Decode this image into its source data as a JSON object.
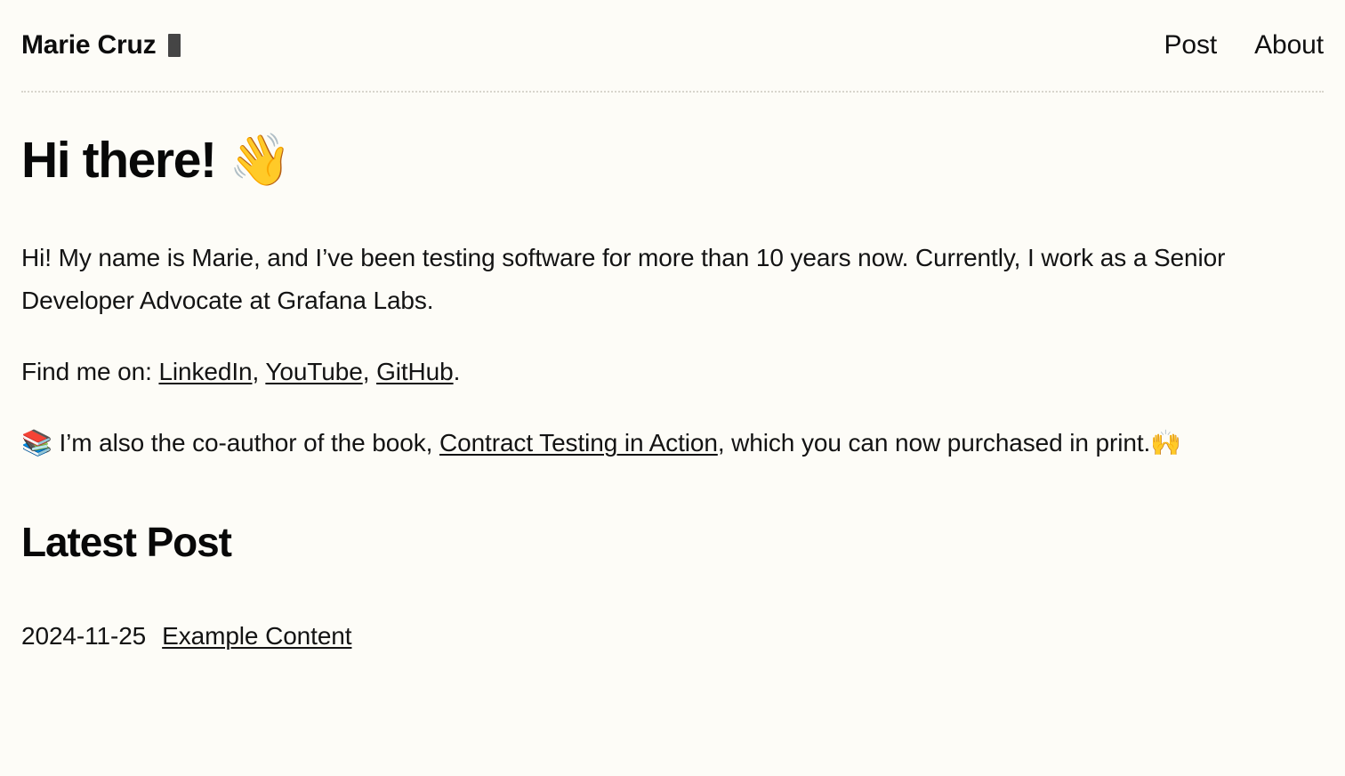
{
  "site": {
    "background_color": "#fdfcf7",
    "text_color": "#131313",
    "caret_color": "#454545"
  },
  "header": {
    "brand_name": "Marie Cruz",
    "caret_icon": "block-caret-icon",
    "nav": [
      {
        "label": "Post"
      },
      {
        "label": "About"
      }
    ]
  },
  "main": {
    "title": "Hi there! 👋",
    "title_text": "Hi there!",
    "title_emoji": "👋",
    "paragraphs": {
      "intro_part1": "Hi! My name is Marie, and I’ve been testing software for more than 10 years now. Currently, I work as a Senior Developer Advocate at Grafana Labs.",
      "find_me_prefix": "Find me on: ",
      "link_linkedin": "LinkedIn",
      "sep_comma_1": ", ",
      "link_youtube": "YouTube",
      "sep_comma_2": ", ",
      "link_github": "GitHub",
      "sep_period": ".",
      "book_emoji": "📚",
      "book_prefix": " I’m also the co-author of the book, ",
      "link_book": "Contract Testing in Action",
      "book_suffix": ", which you can now purchased in print.",
      "hands_emoji": "🙌"
    },
    "section_title": "Latest Post",
    "posts": [
      {
        "date": "2024-11-25",
        "title": "Example Content"
      }
    ]
  }
}
